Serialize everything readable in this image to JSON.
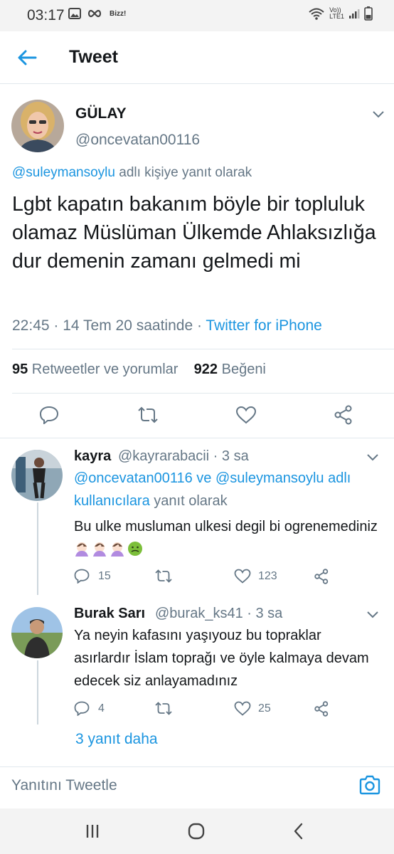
{
  "status_bar": {
    "time": "03:17",
    "carrier_label": "Bizz!",
    "network_label_top": "Vo))",
    "network_label_bottom": "LTE1"
  },
  "header": {
    "title": "Tweet"
  },
  "tweet": {
    "author_name": "GÜLAY",
    "author_handle": "@oncevatan00116",
    "reply_mention": "@suleymansoylu",
    "reply_suffix": " adlı kişiye yanıt olarak",
    "text": "Lgbt kapatın bakanım böyle bir topluluk olamaz Müslüman Ülkemde Ahlaksızlığa dur demenin zamanı gelmedi mi",
    "timestamp": "22:45 · 14 Tem 20 saatinde · ",
    "source": "Twitter for iPhone",
    "retweets_count": "95",
    "retweets_label": " Retweetler ve yorumlar",
    "likes_count": "922",
    "likes_label": " Beğeni"
  },
  "replies": [
    {
      "name": "kayra",
      "handle": "@kayrarabacii · 3 sa",
      "context_mentions": "@oncevatan00116 ve @suleymansoylu adlı kullanıcılara",
      "context_suffix": " yanıt olarak",
      "text": "Bu ulke musluman ulkesi degil bi ogrenemediniz",
      "emojis": [
        "facepalm-emoji",
        "facepalm-emoji",
        "facepalm-emoji",
        "nauseated-face-emoji"
      ],
      "reply_count": "15",
      "retweet_count": "",
      "like_count": "123"
    },
    {
      "name": "Burak Sarı",
      "handle": "@burak_ks41 · 3 sa",
      "text": "Ya neyin kafasını yaşıyouz bu topraklar asırlardır İslam toprağı ve öyle kalmaya devam edecek siz anlayamadınız",
      "reply_count": "4",
      "retweet_count": "",
      "like_count": "25"
    }
  ],
  "more_replies_label": "3 yanıt daha",
  "reply_box": {
    "placeholder": "Yanıtını Tweetle"
  },
  "colors": {
    "accent": "#1b95e0",
    "secondary_text": "#657786",
    "divider": "#e1e8ed"
  },
  "icons": [
    "back-arrow-icon",
    "chevron-down-icon",
    "reply-icon",
    "retweet-icon",
    "like-icon",
    "share-icon",
    "camera-icon",
    "recent-apps-icon",
    "home-icon",
    "back-icon"
  ]
}
